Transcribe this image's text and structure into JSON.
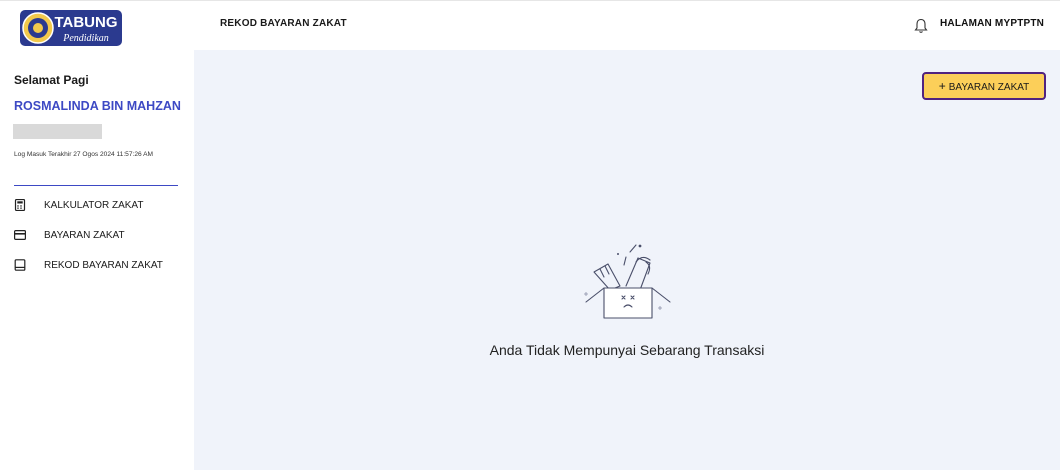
{
  "header": {
    "logo_text_top": "TABUNG",
    "logo_text_bottom": "Pendidikan",
    "page_title": "REKOD BAYARAN ZAKAT",
    "portal_link": "HALAMAN MYPTPTN",
    "notification_icon": "bell-icon"
  },
  "sidebar": {
    "greeting": "Selamat Pagi",
    "user_name": "ROSMALINDA BIN MAHZAN",
    "last_login": "Log Masuk Terakhir 27 Ogos 2024 11:57:26 AM",
    "accent_color": "#3d49c4",
    "items": [
      {
        "label": "KALKULATOR ZAKAT",
        "icon": "calculator-icon"
      },
      {
        "label": "BAYARAN ZAKAT",
        "icon": "credit-card-icon"
      },
      {
        "label": "REKOD BAYARAN ZAKAT",
        "icon": "record-icon"
      }
    ]
  },
  "main": {
    "add_button_label": "BAYARAN ZAKAT",
    "add_button_icon": "plus-icon",
    "add_button_color": "#fccf59",
    "add_button_border": "#51237f",
    "empty_icon": "empty-box-icon",
    "empty_message": "Anda Tidak Mempunyai Sebarang Transaksi",
    "background": "#f0f3fa"
  }
}
